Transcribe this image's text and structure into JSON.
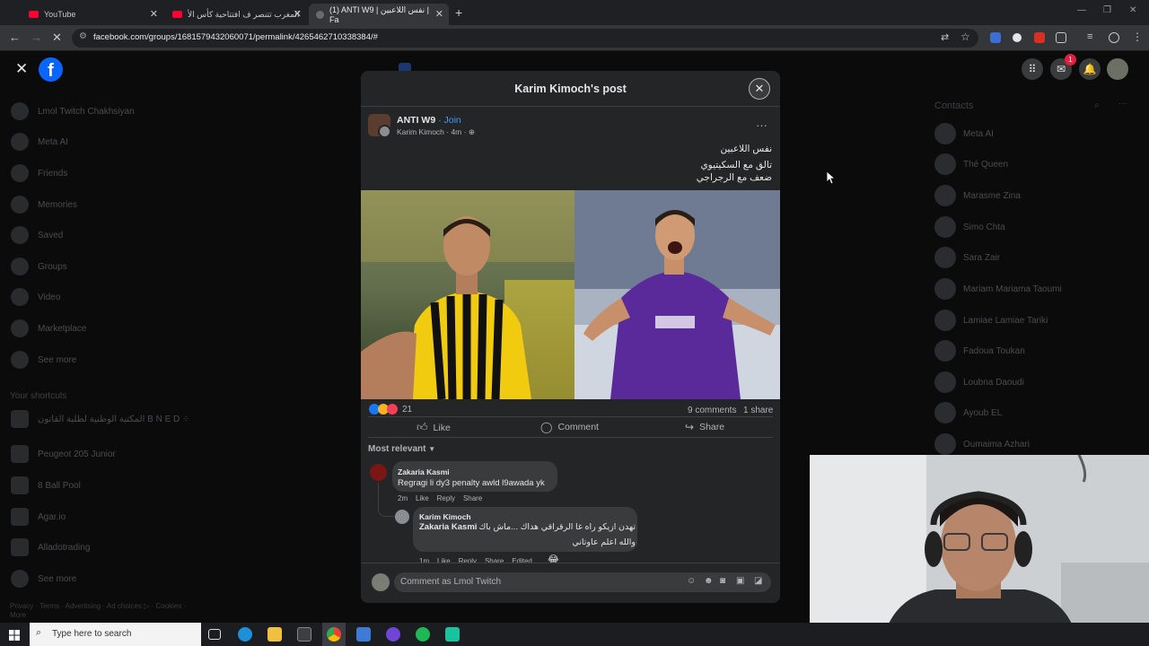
{
  "browser": {
    "tabs": [
      {
        "label": "YouTube"
      },
      {
        "label": "المغرب تتنصر ف افتتاحية كأس الأ"
      },
      {
        "label": "(1) ANTI W9 | نفس اللاعبين | Fa"
      }
    ],
    "url": "facebook.com/groups/1681579432060071/permalink/4265462710338384/#"
  },
  "sidebar": {
    "items": [
      {
        "label": "Lmol Twitch Chakhsiyan"
      },
      {
        "label": "Meta AI"
      },
      {
        "label": "Friends"
      },
      {
        "label": "Memories"
      },
      {
        "label": "Saved"
      },
      {
        "label": "Groups"
      },
      {
        "label": "Video"
      },
      {
        "label": "Marketplace"
      },
      {
        "label": "See more"
      }
    ],
    "shortcuts_title": "Your shortcuts",
    "shortcuts": [
      {
        "label": "المكتبة الوطنية لطلبة القانون B N E D ⁘"
      },
      {
        "label": "Peugeot 205 Junior"
      },
      {
        "label": "8 Ball Pool"
      },
      {
        "label": "Agar.io"
      },
      {
        "label": "Alladotrading"
      },
      {
        "label": "See more"
      }
    ],
    "footer": "Privacy · Terms · Advertising · Ad choices ▷ · Cookies · More"
  },
  "contacts": {
    "title": "Contacts",
    "items": [
      "Meta AI",
      "Thé Queen",
      "Marasme Zina",
      "Simo Chta",
      "Sara Zair",
      "Mariam Mariama Taoumi",
      "Lamiae Lamiae Tariki",
      "Fadoua Toukan",
      "Loubna Daoudi",
      "Ayoub EL",
      "Oumaima Azhari"
    ]
  },
  "notifications": {
    "messenger_badge": "1"
  },
  "modal": {
    "title": "Karim Kimoch's post",
    "group_name": "ANTI W9",
    "join_label": "· Join",
    "author_meta": "Karim Kimoch · 4m ·",
    "post_lines": [
      "نفس اللاعبين",
      "تالق مع السكيتيوي",
      "ضعف مع الرجراجي"
    ],
    "reactions_count": "21",
    "comments_count": "9 comments",
    "shares_count": "1 share",
    "like_label": "Like",
    "comment_label": "Comment",
    "share_label": "Share",
    "sort_label": "Most relevant",
    "comments": [
      {
        "author": "Zakaria Kasmi",
        "text": "Regragi li dy3 penalty awld l9awada yk",
        "time": "2m",
        "like": "Like",
        "reply": "Reply",
        "share": "Share"
      },
      {
        "author": "Karim Kimoch",
        "mention": "Zakaria Kasmi",
        "text_line1": "تهدن ازيكو راه غا الرقراقي هداك ...ماش باك",
        "text_line2": "والله اعلم عاوتاني",
        "time": "1m",
        "like": "Like",
        "reply": "Reply",
        "share": "Share",
        "edited": "Edited"
      }
    ],
    "input_placeholder": "Comment as Lmol Twitch"
  },
  "taskbar": {
    "search_placeholder": "Type here to search"
  },
  "colors": {
    "fb_blue": "#0866ff",
    "modal_bg": "#242526",
    "link_blue": "#4599ff"
  }
}
